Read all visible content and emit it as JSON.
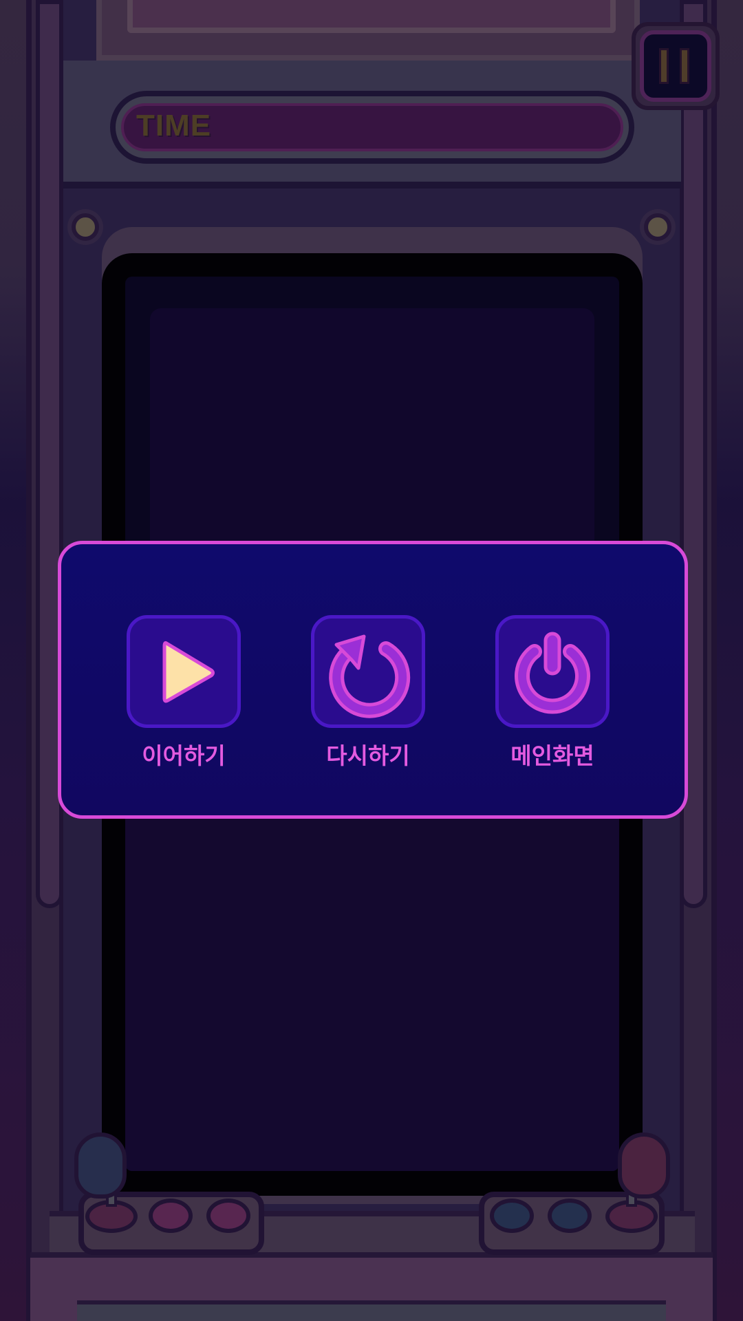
{
  "hud": {
    "time_label": "TIME",
    "time_remaining_fraction": 0
  },
  "pause_button": {
    "icon": "pause-icon"
  },
  "pause_menu": {
    "items": [
      {
        "label": "이어하기",
        "icon": "play-icon",
        "icon_color": "#fde1a8"
      },
      {
        "label": "다시하기",
        "icon": "restart-icon",
        "icon_color": "#c43fe0"
      },
      {
        "label": "메인화면",
        "icon": "power-icon",
        "icon_color": "#c43fe0"
      }
    ]
  },
  "colors": {
    "panel_bg": "#110764",
    "panel_border": "#d84ad8",
    "label": "#e45be0",
    "icon_box": "#2a0c8e"
  }
}
